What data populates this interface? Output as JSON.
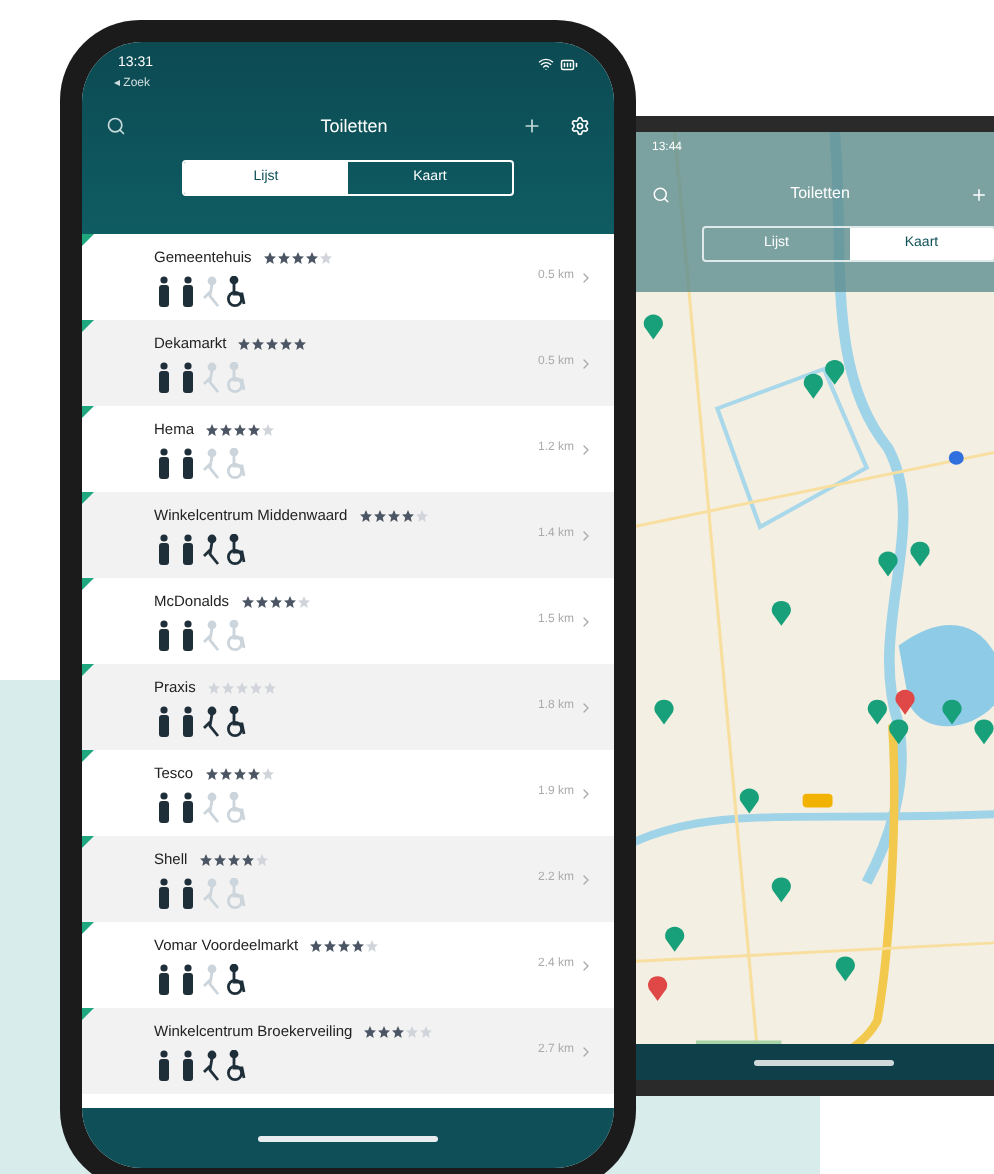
{
  "list_phone": {
    "status_time": "13:31",
    "back_link": "◂ Zoek",
    "title": "Toiletten",
    "tabs": [
      {
        "label": "Lijst",
        "selected": true
      },
      {
        "label": "Kaart",
        "selected": false
      }
    ],
    "rows": [
      {
        "name": "Gemeentehuis",
        "stars": 4,
        "distance": "0.5 km",
        "facilities": [
          {
            "kind": "toilet",
            "available": true
          },
          {
            "kind": "toilet",
            "available": true
          },
          {
            "kind": "changing",
            "available": false
          },
          {
            "kind": "wheelchair",
            "available": true
          }
        ]
      },
      {
        "name": "Dekamarkt",
        "stars": 5,
        "distance": "0.5 km",
        "facilities": [
          {
            "kind": "toilet",
            "available": true
          },
          {
            "kind": "toilet",
            "available": true
          },
          {
            "kind": "changing",
            "available": false
          },
          {
            "kind": "wheelchair",
            "available": false
          }
        ]
      },
      {
        "name": "Hema",
        "stars": 4,
        "distance": "1.2 km",
        "facilities": [
          {
            "kind": "toilet",
            "available": true
          },
          {
            "kind": "toilet",
            "available": true
          },
          {
            "kind": "changing",
            "available": false
          },
          {
            "kind": "wheelchair",
            "available": false
          }
        ]
      },
      {
        "name": "Winkelcentrum Middenwaard",
        "stars": 4,
        "distance": "1.4 km",
        "facilities": [
          {
            "kind": "toilet",
            "available": true
          },
          {
            "kind": "toilet",
            "available": true
          },
          {
            "kind": "changing",
            "available": true
          },
          {
            "kind": "wheelchair",
            "available": true
          }
        ]
      },
      {
        "name": "McDonalds",
        "stars": 4,
        "distance": "1.5 km",
        "facilities": [
          {
            "kind": "toilet",
            "available": true
          },
          {
            "kind": "toilet",
            "available": true
          },
          {
            "kind": "changing",
            "available": false
          },
          {
            "kind": "wheelchair",
            "available": false
          }
        ]
      },
      {
        "name": "Praxis",
        "stars": 0,
        "distance": "1.8 km",
        "facilities": [
          {
            "kind": "toilet",
            "available": true
          },
          {
            "kind": "toilet",
            "available": true
          },
          {
            "kind": "changing",
            "available": true
          },
          {
            "kind": "wheelchair",
            "available": true
          }
        ]
      },
      {
        "name": "Tesco",
        "stars": 4,
        "distance": "1.9 km",
        "facilities": [
          {
            "kind": "toilet",
            "available": true
          },
          {
            "kind": "toilet",
            "available": true
          },
          {
            "kind": "changing",
            "available": false
          },
          {
            "kind": "wheelchair",
            "available": false
          }
        ]
      },
      {
        "name": "Shell",
        "stars": 4,
        "distance": "2.2 km",
        "facilities": [
          {
            "kind": "toilet",
            "available": true
          },
          {
            "kind": "toilet",
            "available": true
          },
          {
            "kind": "changing",
            "available": false
          },
          {
            "kind": "wheelchair",
            "available": false
          }
        ]
      },
      {
        "name": "Vomar Voordeelmarkt",
        "stars": 4,
        "distance": "2.4 km",
        "facilities": [
          {
            "kind": "toilet",
            "available": true
          },
          {
            "kind": "toilet",
            "available": true
          },
          {
            "kind": "changing",
            "available": false
          },
          {
            "kind": "wheelchair",
            "available": true
          }
        ]
      },
      {
        "name": "Winkelcentrum Broekerveiling",
        "stars": 3,
        "distance": "2.7 km",
        "facilities": [
          {
            "kind": "toilet",
            "available": true
          },
          {
            "kind": "toilet",
            "available": true
          },
          {
            "kind": "changing",
            "available": true
          },
          {
            "kind": "wheelchair",
            "available": true
          }
        ]
      }
    ]
  },
  "map_phone": {
    "status_time": "13:44",
    "title": "Toiletten",
    "tabs": [
      {
        "label": "Lijst",
        "selected": false
      },
      {
        "label": "Kaart",
        "selected": true
      }
    ]
  }
}
